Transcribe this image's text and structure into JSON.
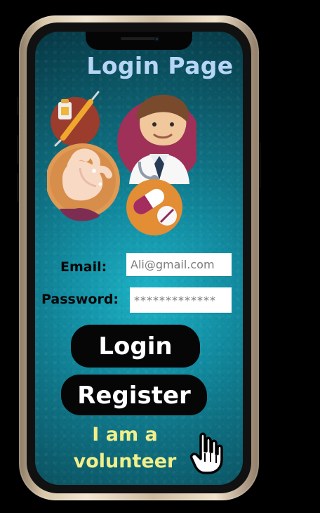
{
  "login": {
    "title": "Login Page",
    "email_label": "Email:",
    "email_value": "Ali@gmail.com",
    "password_label": "Password:",
    "password_value": "*************",
    "login_button": "Login",
    "register_button": "Register",
    "volunteer_link_line1": "I am a",
    "volunteer_link_line2": "volunteer"
  },
  "icons": {
    "doctor": "doctor-icon",
    "vaccine": "syringe-icon",
    "handwash": "handwash-icon",
    "pills": "pill-icon",
    "cursor": "hand-cursor-icon"
  },
  "colors": {
    "title": "#b7d5f6",
    "volunteer": "#f2ef8a",
    "button_bg": "#060606",
    "screen_mid": "#138ea3"
  }
}
